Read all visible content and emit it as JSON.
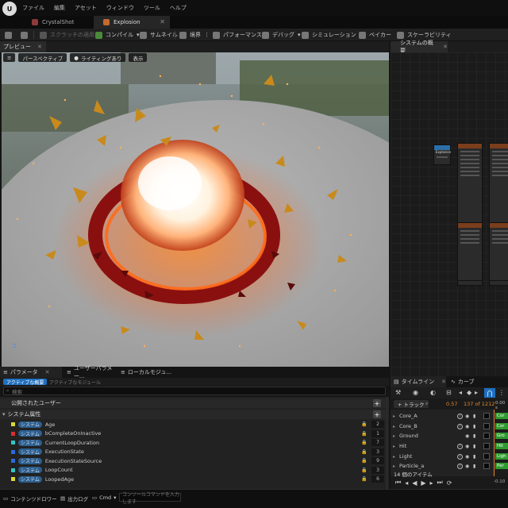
{
  "menu": {
    "logo": "U",
    "items": [
      "ファイル",
      "編集",
      "アセット",
      "ウィンドウ",
      "ツール",
      "ヘルプ"
    ]
  },
  "tabs": [
    {
      "label": "CrystalShot",
      "active": false
    },
    {
      "label": "Explosion",
      "active": true
    }
  ],
  "toolbar": {
    "apply_scratch": "スクラッチの適用",
    "compile": "コンパイル",
    "thumbnail": "サムネイル",
    "bounds": "境界",
    "performance": "パフォーマンス",
    "debug": "デバッグ",
    "simulation": "シミュレーション",
    "baker": "ベイカー",
    "scalability": "スケーラビリティ"
  },
  "preview": {
    "tab_label": "プレビュー",
    "perspective": "パースペクティブ",
    "lighting": "ライティングあり",
    "show": "表示",
    "axis_label": "Z"
  },
  "graph": {
    "tab_label": "システムの概要",
    "node_label": "Explosion"
  },
  "parameters": {
    "tabs": [
      "パラメータ",
      "ユーザーパラメー...",
      "ローカルモジュ..."
    ],
    "filter_active": "アクティブな概要",
    "filter_modules": "アクティブなモジュール",
    "search_placeholder": "検索",
    "public_user_section": "公開されたユーザー",
    "system_attributes_section": "システム属性",
    "badge": "システム",
    "rows": [
      {
        "name": "Age",
        "count": "2"
      },
      {
        "name": "bCompleteOnInactive",
        "count": "1"
      },
      {
        "name": "CurrentLoopDuration",
        "count": "7"
      },
      {
        "name": "ExecutionState",
        "count": "3"
      },
      {
        "name": "ExecutionStateSource",
        "count": "9"
      },
      {
        "name": "LoopCount",
        "count": "3"
      },
      {
        "name": "LoopedAge",
        "count": "6"
      }
    ],
    "swatch_colors": [
      "#d8d83a",
      "#d83030",
      "#37c2c2",
      "#2a6bd8",
      "#2a6bd8",
      "#37c2c2",
      "#d8d83a"
    ]
  },
  "timeline": {
    "tabs": [
      "タイムライン",
      "カーブ"
    ],
    "add_track": "+ トラック",
    "time": "0.57",
    "frame": "137 of 1212",
    "ruler": "0.00 s",
    "tracks": [
      "Core_A",
      "Core_B",
      "Ground",
      "Hit",
      "Light",
      "Particle_a"
    ],
    "green_bars": [
      "Cor",
      "Cor",
      "Gro",
      "Hit",
      "Ligh",
      "Par"
    ],
    "footer_count": "14 個のアイテム",
    "end_time": "-0.10"
  },
  "statusbar": {
    "content_drawer": "コンテンツドロワー",
    "output_log": "出力ログ",
    "cmd": "Cmd",
    "cmd_placeholder": "コンソールコマンドを入力します"
  }
}
